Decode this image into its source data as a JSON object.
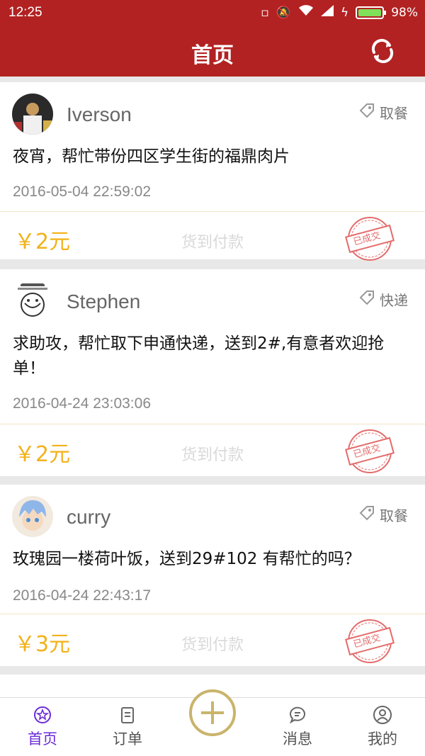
{
  "status_bar": {
    "time": "12:25",
    "battery": "98%",
    "icons": [
      "sim-icon",
      "mute-icon",
      "wifi-icon",
      "signal-icon",
      "charging-icon",
      "battery-icon"
    ]
  },
  "app_bar": {
    "title": "首页",
    "refresh_icon": "refresh-icon",
    "color": "#b22222"
  },
  "posts": [
    {
      "username": "Iverson",
      "tag": "取餐",
      "content": "夜宵，帮忙带份四区学生街的福鼎肉片",
      "time": "2016-05-04 22:59:02",
      "price": "￥2元",
      "payment": "货到付款",
      "stamp": "已成交"
    },
    {
      "username": "Stephen",
      "tag": "快递",
      "content": "求助攻，帮忙取下申通快递，送到2#,有意者欢迎抢单！",
      "time": "2016-04-24 23:03:06",
      "price": "￥2元",
      "payment": "货到付款",
      "stamp": "已成交"
    },
    {
      "username": "curry",
      "tag": "取餐",
      "content": "玫瑰园一楼荷叶饭，送到29#102 有帮忙的吗？",
      "time": "2016-04-24 22:43:17",
      "price": "￥3元",
      "payment": "货到付款",
      "stamp": "已成交"
    }
  ],
  "bottom_nav": {
    "items": [
      {
        "label": "首页",
        "icon": "home-star-icon",
        "active": true
      },
      {
        "label": "订单",
        "icon": "order-clipboard-icon",
        "active": false
      },
      {
        "label": "",
        "icon": "add-plus-icon",
        "active": false
      },
      {
        "label": "消息",
        "icon": "message-bubble-icon",
        "active": false
      },
      {
        "label": "我的",
        "icon": "profile-user-icon",
        "active": false
      }
    ]
  },
  "colors": {
    "price": "#f2b21a",
    "active_nav": "#6a2bd9",
    "stamp": "#e46b6b"
  }
}
